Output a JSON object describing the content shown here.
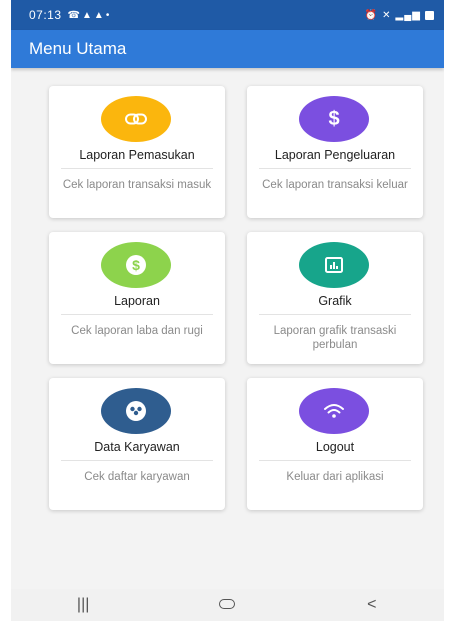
{
  "status_bar": {
    "time": "07:13",
    "left_icons": [
      "phone-icon",
      "warning-icon",
      "warning-icon",
      "dot-icon"
    ],
    "right_icons": [
      "alarm-icon",
      "mute-icon",
      "signal-icon",
      "battery-icon"
    ]
  },
  "app_bar": {
    "title": "Menu Utama",
    "color": "#2f7ad8"
  },
  "cards": [
    {
      "title": "Laporan Pemasukan",
      "desc": "Cek laporan transaksi masuk",
      "icon": "link-icon",
      "color": "#fbb60d"
    },
    {
      "title": "Laporan Pengeluaran",
      "desc": "Cek laporan transaksi keluar",
      "icon": "dollar-icon",
      "color": "#7b4fe0"
    },
    {
      "title": "Laporan",
      "desc": "Cek laporan laba dan rugi",
      "icon": "money-icon",
      "color": "#8dd34c"
    },
    {
      "title": "Grafik",
      "desc": "Laporan grafik transaski perbulan",
      "icon": "chart-icon",
      "color": "#17a58b"
    },
    {
      "title": "Data Karyawan",
      "desc": "Cek daftar karyawan",
      "icon": "people-icon",
      "color": "#2f5d8f"
    },
    {
      "title": "Logout",
      "desc": "Keluar dari aplikasi",
      "icon": "wifi-icon",
      "color": "#7b4fe0"
    }
  ],
  "nav_bar": {
    "buttons": [
      "recent-apps-icon",
      "home-icon",
      "back-icon"
    ]
  }
}
